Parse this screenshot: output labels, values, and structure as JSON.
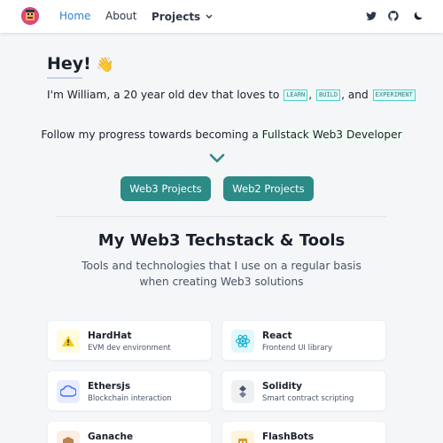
{
  "nav": {
    "home": "Home",
    "about": "About",
    "projects": "Projects",
    "icons": [
      "twitter-icon",
      "github-icon",
      "moon-icon"
    ]
  },
  "hero": {
    "title": "Hey!",
    "wave_emoji": "👋",
    "intro_prefix": "I'm William, a 20 year old dev that loves to",
    "tags": [
      "LEARN",
      "BUILD",
      "EXPERIMENT"
    ],
    "and": "and",
    "follow_prefix": "Follow my progress towards becoming a",
    "follow_highlight": "Fullstack Web3 Developer"
  },
  "buttons": {
    "web3": "Web3 Projects",
    "web2": "Web2 Projects"
  },
  "techstack": {
    "title": "My Web3 Techstack & Tools",
    "subtitle": "Tools and technologies that I use on a regular basis when creating Web3 solutions",
    "cards": [
      {
        "title": "HardHat",
        "desc": "EVM dev environment",
        "icon": "hardhat-icon",
        "color": "#fffbdd"
      },
      {
        "title": "React",
        "desc": "Frontend UI library",
        "icon": "react-icon",
        "color": "#e0f7fb"
      },
      {
        "title": "Ethersjs",
        "desc": "Blockchain interaction",
        "icon": "ethersjs-icon",
        "color": "#e7ecff"
      },
      {
        "title": "Solidity",
        "desc": "Smart contract scripting",
        "icon": "solidity-icon",
        "color": "#eef0f2"
      },
      {
        "title": "Ganache",
        "desc": "",
        "icon": "ganache-icon",
        "color": "#fdeee3"
      },
      {
        "title": "FlashBots",
        "desc": "",
        "icon": "flashbots-icon",
        "color": "#fff4dd"
      }
    ]
  },
  "colors": {
    "accent": "#3182ce",
    "button": "#2c8a87",
    "tag": "#2c7a7b"
  }
}
